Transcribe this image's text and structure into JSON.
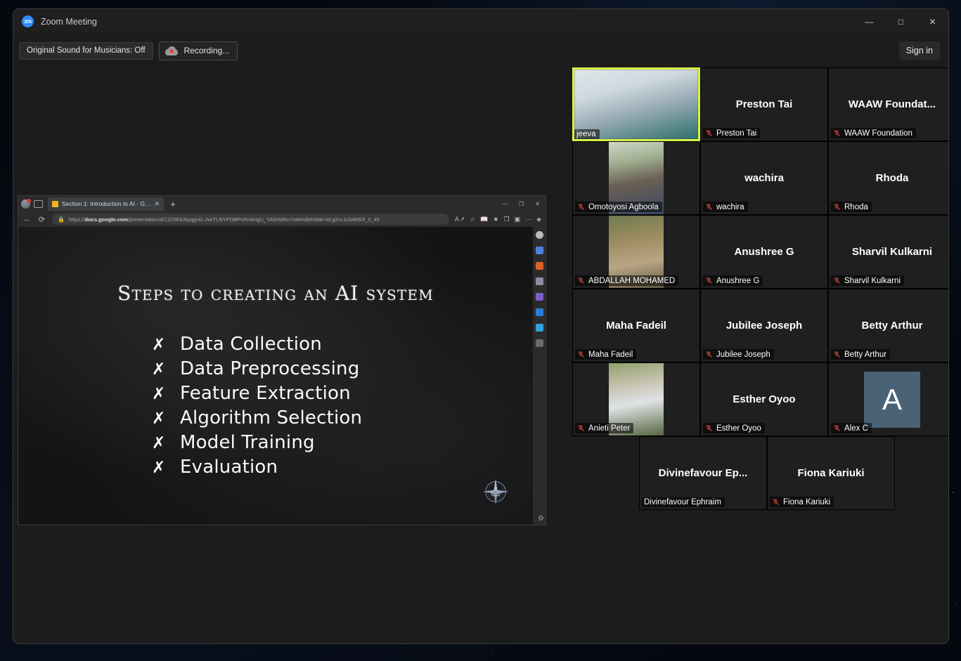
{
  "window": {
    "app_icon": "zoom-logo-icon",
    "app_icon_text": "zm",
    "title": "Zoom Meeting",
    "minimize": "—",
    "maximize": "□",
    "close": "✕"
  },
  "toolbar": {
    "original_sound_label": "Original Sound for Musicians: Off",
    "recording_label": "Recording...",
    "recording_icon": "cloud-record-icon",
    "sign_in_label": "Sign in"
  },
  "browser": {
    "tab_title": "Section 1: Introduction to AI - G…",
    "tab_close": "✕",
    "new_tab": "+",
    "back": "←",
    "reload": "⟳",
    "lock_icon": "lock-icon",
    "url_prefix": "https://",
    "url_domain": "docs.google.com",
    "url_path": "/presentation/d/1225Eb3IpqgnG-JveTLNYPDBPxRn4HgU_YA6rlsRm7sM/edit#slide=id.g2cc1cbd650f_0_45",
    "omnibox_icons": [
      "read-aloud-icon",
      "favorite-star-icon",
      "immersive-reader-icon",
      "add-favorites-icon",
      "collections-icon",
      "split-screen-icon",
      "more-options-icon",
      "copilot-icon"
    ],
    "win_min": "—",
    "win_restore": "❐",
    "win_close": "✕",
    "sidebar_icons": [
      "search-icon",
      "shopping-icon",
      "tools-icon",
      "games-icon",
      "office-icon",
      "outlook-icon",
      "telegram-icon",
      "add-app-icon"
    ],
    "settings_icon": "gear-icon"
  },
  "slide": {
    "title": "Steps to creating an AI system",
    "bullet_mark": "✗",
    "items": [
      "Data Collection",
      "Data Preprocessing",
      "Feature Extraction",
      "Algorithm Selection",
      "Model Training",
      "Evaluation"
    ],
    "logo": "compass-logo-icon"
  },
  "participants": {
    "mute_icon": "mic-muted-icon",
    "rows": [
      [
        {
          "name": "jeeva",
          "display": "jeeva",
          "muted": false,
          "active_speaker": true,
          "video": "video-thumbnail",
          "show_big_name": false
        },
        {
          "name": "Preston Tai",
          "display": "Preston Tai",
          "muted": true,
          "active_speaker": false,
          "show_big_name": true
        },
        {
          "name": "WAAW  Foundat...",
          "display": "WAAW Foundation",
          "muted": true,
          "active_speaker": false,
          "show_big_name": true
        }
      ],
      [
        {
          "name": "Omotoyosi Agboola",
          "display": "Omotoyosi Agboola",
          "muted": true,
          "active_speaker": false,
          "photo": "profile-photo",
          "show_big_name": false
        },
        {
          "name": "wachira",
          "display": "wachira",
          "muted": true,
          "active_speaker": false,
          "show_big_name": true
        },
        {
          "name": "Rhoda",
          "display": "Rhoda",
          "muted": true,
          "active_speaker": false,
          "show_big_name": true
        }
      ],
      [
        {
          "name": "ABDALLAH MOHAMED",
          "display": "ABDALLAH MOHAMED",
          "muted": true,
          "active_speaker": false,
          "photo": "profile-photo",
          "show_big_name": false
        },
        {
          "name": "Anushree G",
          "display": "Anushree G",
          "muted": true,
          "active_speaker": false,
          "show_big_name": true
        },
        {
          "name": "Sharvil Kulkarni",
          "display": "Sharvil Kulkarni",
          "muted": true,
          "active_speaker": false,
          "show_big_name": true
        }
      ],
      [
        {
          "name": "Maha Fadeil",
          "display": "Maha Fadeil",
          "muted": true,
          "active_speaker": false,
          "show_big_name": true
        },
        {
          "name": "Jubilee Joseph",
          "display": "Jubilee Joseph",
          "muted": true,
          "active_speaker": false,
          "show_big_name": true
        },
        {
          "name": "Betty Arthur",
          "display": "Betty Arthur",
          "muted": true,
          "active_speaker": false,
          "show_big_name": true
        }
      ],
      [
        {
          "name": "Anieti Peter",
          "display": "Anieti Peter",
          "muted": true,
          "active_speaker": false,
          "photo": "profile-photo",
          "show_big_name": false
        },
        {
          "name": "Esther Oyoo",
          "display": "Esther Oyoo",
          "muted": true,
          "active_speaker": false,
          "show_big_name": true
        },
        {
          "name": "Alex C",
          "display": "Alex C",
          "muted": true,
          "active_speaker": false,
          "avatar_letter": "A",
          "show_big_name": false
        }
      ],
      [
        {
          "name": "Divinefavour  Ep...",
          "display": "Divinefavour Ephraim",
          "muted": false,
          "active_speaker": false,
          "show_big_name": true
        },
        {
          "name": "Fiona Kariuki",
          "display": "Fiona Kariuki",
          "muted": true,
          "active_speaker": false,
          "show_big_name": true
        }
      ]
    ]
  },
  "colors": {
    "active_speaker_border": "#d9f24a",
    "mute_red": "#e8493a",
    "zoom_blue": "#2d8cff",
    "avatar_bg": "#4a6275"
  }
}
